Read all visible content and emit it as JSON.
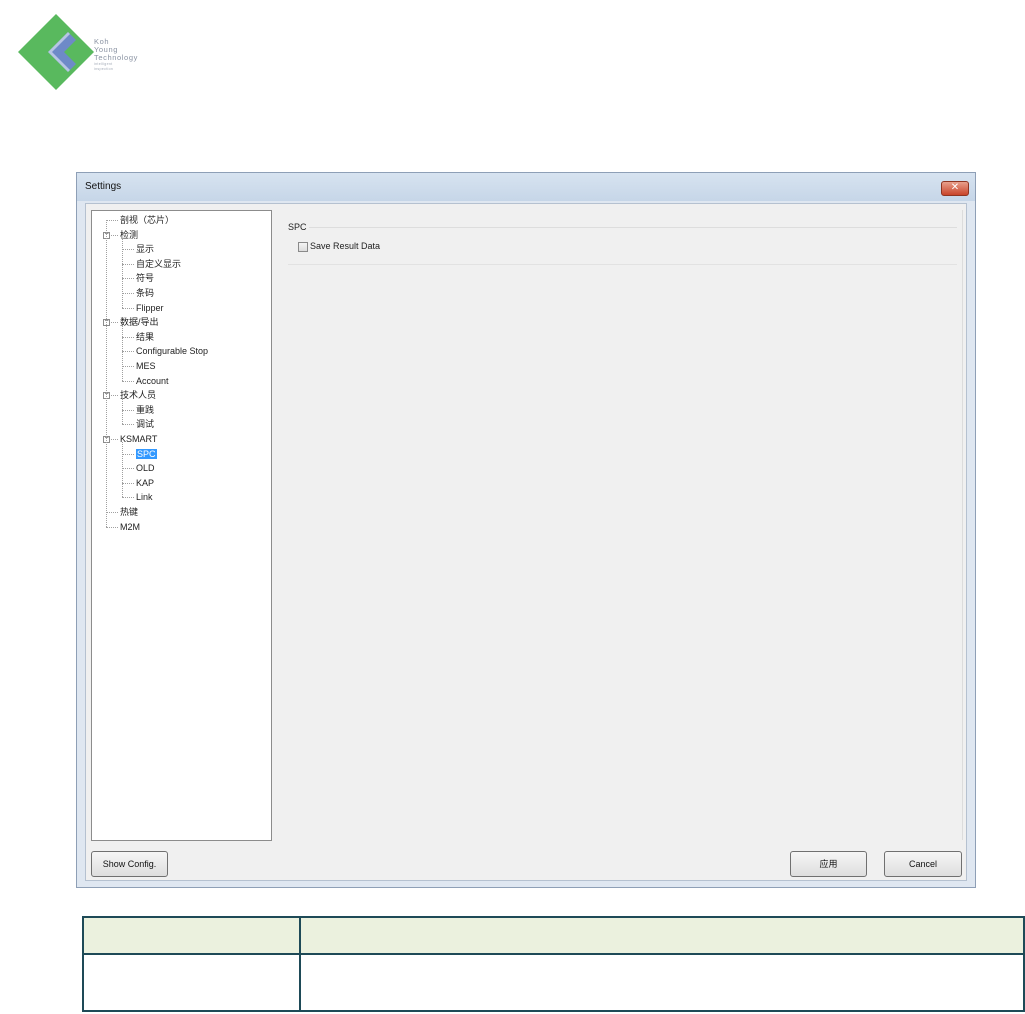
{
  "logo": {
    "line1": "Koh",
    "line2": "Young",
    "line3": "Technology",
    "tagline1": "intelligent",
    "tagline2": "inspection",
    "colors": {
      "green": "#59b95e",
      "blue": "#6e8ac8",
      "gray": "#8a93a3"
    }
  },
  "window": {
    "title": "Settings",
    "close_glyph": "✕"
  },
  "tree": {
    "items": [
      {
        "label": "剖视（芯片）",
        "level": 0
      },
      {
        "label": "检测",
        "level": 0,
        "expanded": true
      },
      {
        "label": "显示",
        "level": 1
      },
      {
        "label": "自定义显示",
        "level": 1
      },
      {
        "label": "符号",
        "level": 1
      },
      {
        "label": "条码",
        "level": 1
      },
      {
        "label": "Flipper",
        "level": 1
      },
      {
        "label": "数据/导出",
        "level": 0,
        "expanded": true
      },
      {
        "label": "结果",
        "level": 1
      },
      {
        "label": "Configurable Stop",
        "level": 1
      },
      {
        "label": "MES",
        "level": 1
      },
      {
        "label": "Account",
        "level": 1
      },
      {
        "label": "技术人员",
        "level": 0,
        "expanded": true
      },
      {
        "label": "重践",
        "level": 1
      },
      {
        "label": "调试",
        "level": 1
      },
      {
        "label": "KSMART",
        "level": 0,
        "expanded": true
      },
      {
        "label": "SPC",
        "level": 1,
        "selected": true
      },
      {
        "label": "OLD",
        "level": 1
      },
      {
        "label": "KAP",
        "level": 1
      },
      {
        "label": "Link",
        "level": 1
      },
      {
        "label": "热键",
        "level": 0
      },
      {
        "label": "M2M",
        "level": 0
      }
    ]
  },
  "panel": {
    "group_title": "SPC",
    "checkbox_label": "Save Result Data",
    "checkbox_checked": false
  },
  "buttons": {
    "show_config": "Show Config.",
    "apply": "应用",
    "cancel": "Cancel"
  },
  "table": {
    "rows": [
      [
        "",
        ""
      ],
      [
        "",
        ""
      ]
    ]
  }
}
